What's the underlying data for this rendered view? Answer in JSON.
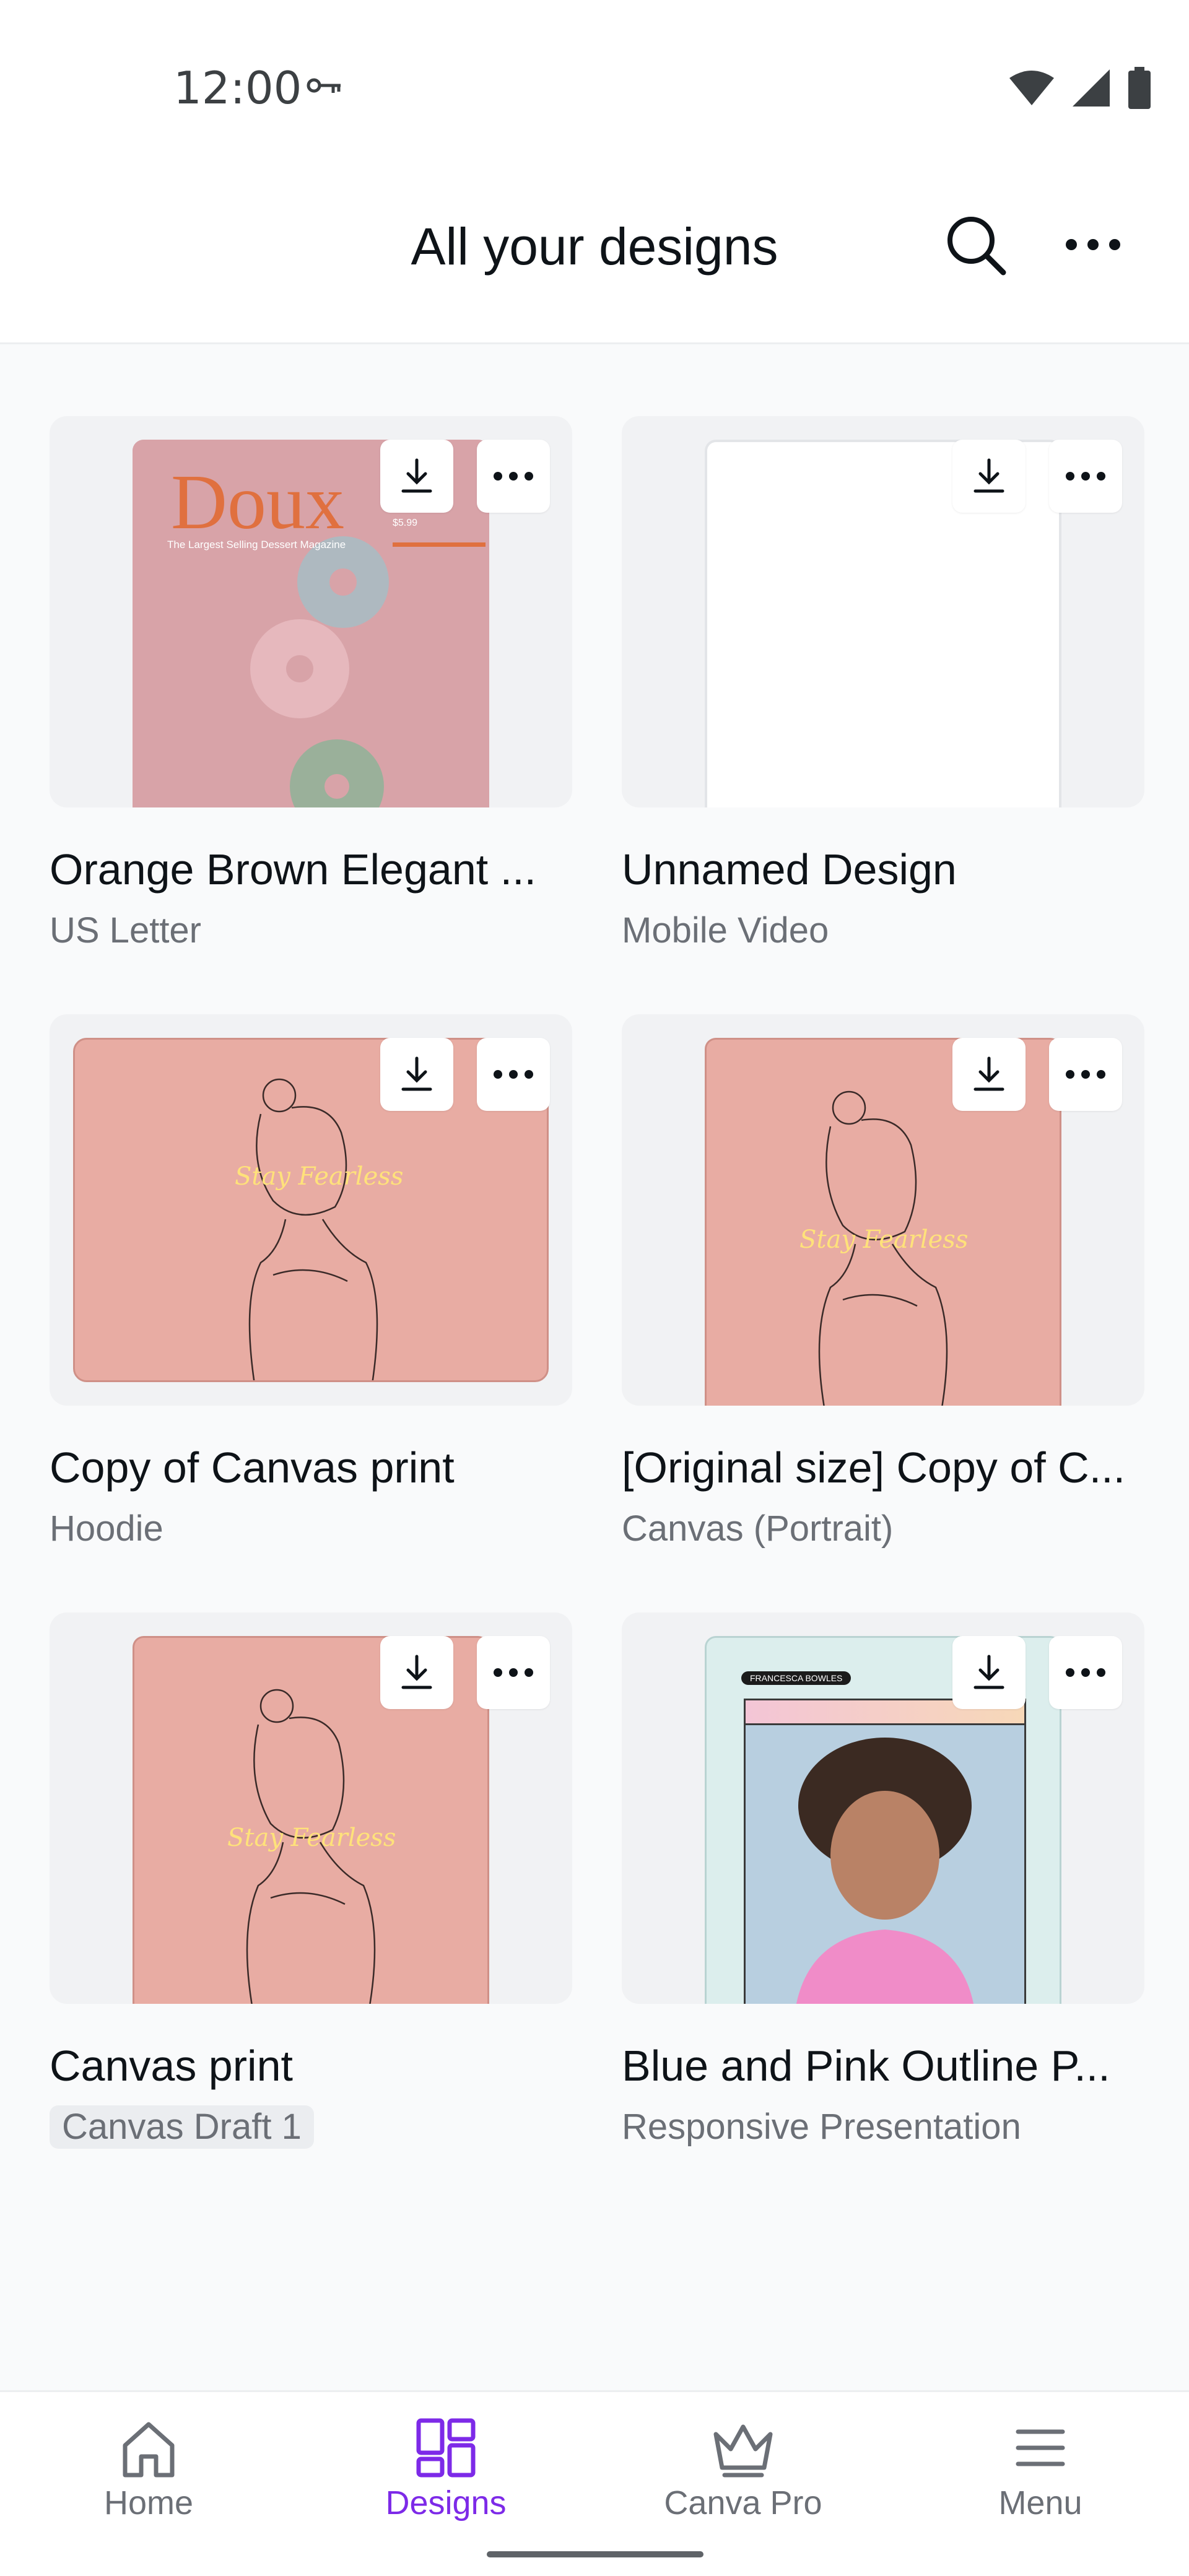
{
  "status_bar": {
    "time": "12:00"
  },
  "header": {
    "title": "All your designs"
  },
  "designs": [
    {
      "name": "Orange Brown Elegant ...",
      "type": "US Letter",
      "art": {
        "title": "Doux",
        "subtitle": "The Largest Selling Dessert Magazine",
        "price": "$5.99"
      }
    },
    {
      "name": "Unnamed Design",
      "type": "Mobile Video"
    },
    {
      "name": "Copy of Canvas print",
      "type": "Hoodie",
      "art": {
        "script": "Stay Fearless"
      }
    },
    {
      "name": "[Original size] Copy of C...",
      "type": "Canvas (Portrait)",
      "art": {
        "script": "Stay Fearless"
      }
    },
    {
      "name": "Canvas print",
      "type": "Canvas Draft 1",
      "art": {
        "script": "Stay Fearless"
      }
    },
    {
      "name": "Blue and Pink Outline P...",
      "type": "Responsive Presentation",
      "art": {
        "tag": "FRANCESCA BOWLES"
      }
    }
  ],
  "nav": {
    "items": [
      {
        "label": "Home",
        "icon": "home-icon"
      },
      {
        "label": "Designs",
        "icon": "designs-grid-icon",
        "active": true
      },
      {
        "label": "Canva Pro",
        "icon": "crown-icon"
      },
      {
        "label": "Menu",
        "icon": "hamburger-menu-icon"
      }
    ]
  },
  "colors": {
    "accent": "#7d2ae8",
    "salmon": "#e8aca3",
    "mint": "#dceeed",
    "text": "#0e1318",
    "muted": "#6b6f76"
  }
}
